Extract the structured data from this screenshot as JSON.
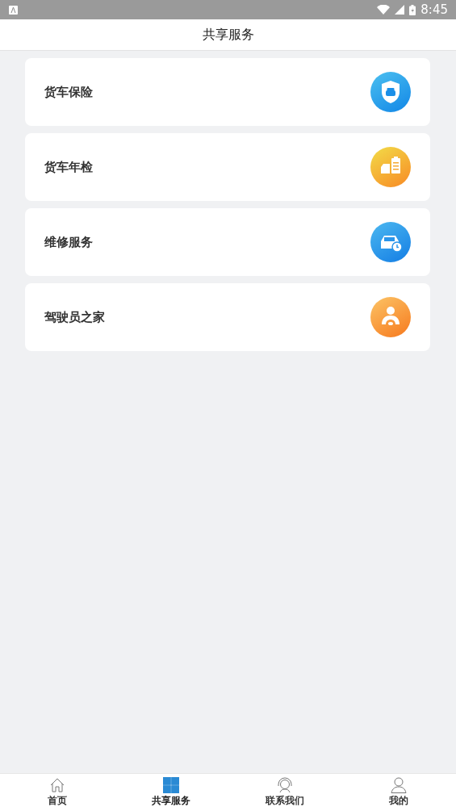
{
  "status_bar": {
    "time": "8:45"
  },
  "header": {
    "title": "共享服务"
  },
  "services": [
    {
      "label": "货车保险"
    },
    {
      "label": "货车年检"
    },
    {
      "label": "维修服务"
    },
    {
      "label": "驾驶员之家"
    }
  ],
  "tabs": [
    {
      "label": "首页",
      "selected": false
    },
    {
      "label": "共享服务",
      "selected": true
    },
    {
      "label": "联系我们",
      "selected": false
    },
    {
      "label": "我的",
      "selected": false
    }
  ]
}
